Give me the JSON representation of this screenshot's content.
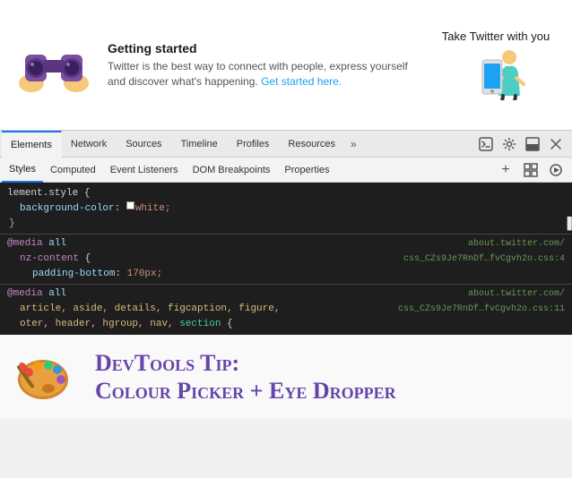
{
  "twitter": {
    "binoculars_alt": "Binoculars illustration",
    "getting_started": "Getting started",
    "description": "Twitter is the best way to connect with people, express yourself and discover what's happening.",
    "get_started_link": "Get started here.",
    "take_with_you": "Take Twitter with you"
  },
  "devtools": {
    "main_tabs": [
      {
        "label": "Elements",
        "active": true
      },
      {
        "label": "Network",
        "active": false
      },
      {
        "label": "Sources",
        "active": false
      },
      {
        "label": "Timeline",
        "active": false
      },
      {
        "label": "Profiles",
        "active": false
      },
      {
        "label": "Resources",
        "active": false
      }
    ],
    "overflow_label": "»",
    "sub_tabs": [
      {
        "label": "Styles",
        "active": true
      },
      {
        "label": "Computed",
        "active": false
      },
      {
        "label": "Event Listeners",
        "active": false
      },
      {
        "label": "DOM Breakpoints",
        "active": false
      },
      {
        "label": "Properties",
        "active": false
      }
    ],
    "css_lines": [
      {
        "text": "lement.style {",
        "indent": 0
      },
      {
        "prop": "background-color",
        "val": "white",
        "has_swatch": true,
        "indent": 1,
        "source_url": ""
      },
      {
        "close": "}",
        "indent": 0
      },
      {
        "media": "@media",
        "media_val": "all",
        "indent": 0,
        "source_right": "about.twitter.com/",
        "source_right2": "css_CZs9Je7RnDf…fvCgvh2o.css:4"
      },
      {
        "prop": "nz-content",
        "brace": "{",
        "indent": 1
      },
      {
        "prop": "padding-bottom",
        "val": "170px",
        "indent": 2,
        "source_right": ""
      },
      {
        "empty": true
      },
      {
        "media": "@media",
        "media_val": "all",
        "indent": 0,
        "source_right": "about.twitter.com/",
        "source_right2": "css_CZs9Je7RnDf…fvCgvh2o.css:11"
      },
      {
        "selector": "article, aside, details, figcaption, figure,",
        "indent": 1
      },
      {
        "selector": "oter, header, hgroup, nav, section {",
        "indent": 1
      }
    ],
    "icons": {
      "plus": "+",
      "cursor_move": "⊹",
      "play": "▶",
      "terminal": ">_",
      "gear": "⚙",
      "dock": "⬒",
      "close": "✕"
    }
  },
  "tip": {
    "icon_alt": "Paint palette with brush",
    "text_line1": "DevTools Tip:",
    "text_line2": "Colour picker + eye dropper"
  }
}
